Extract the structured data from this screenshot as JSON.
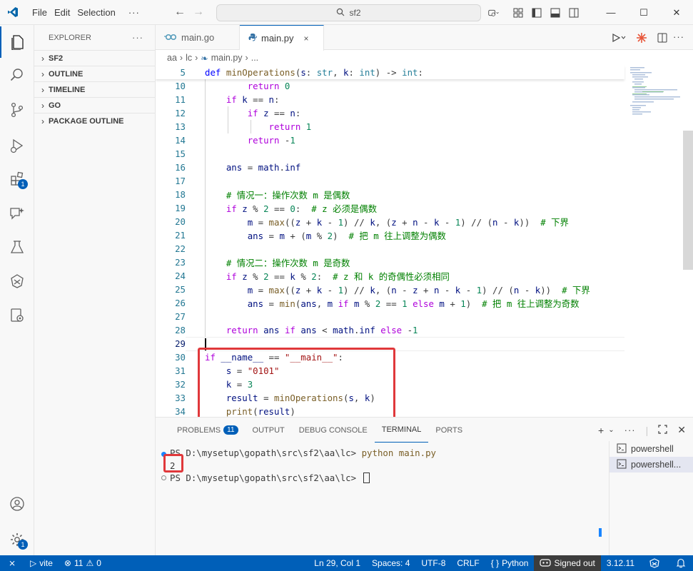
{
  "titlebar": {
    "menu": [
      "File",
      "Edit",
      "Selection"
    ],
    "more": "···",
    "search_text": "sf2"
  },
  "sidebar": {
    "title": "EXPLORER",
    "more": "···",
    "sections": [
      "SF2",
      "OUTLINE",
      "TIMELINE",
      "GO",
      "PACKAGE OUTLINE"
    ]
  },
  "activity": {
    "extensions_badge": "1",
    "accounts_badge": "1"
  },
  "tabs": [
    {
      "label": "main.go",
      "active": false
    },
    {
      "label": "main.py",
      "active": true,
      "close": "×"
    }
  ],
  "breadcrumb": [
    "aa",
    "lc",
    "main.py",
    "..."
  ],
  "editor": {
    "sticky": {
      "line": "5",
      "text": "def minOperations(s: str, k: int) -> int:"
    },
    "lines": [
      {
        "n": "10",
        "text": "        return 0"
      },
      {
        "n": "11",
        "text": "    if k == n:"
      },
      {
        "n": "12",
        "text": "        if z == n:"
      },
      {
        "n": "13",
        "text": "            return 1"
      },
      {
        "n": "14",
        "text": "        return -1"
      },
      {
        "n": "15",
        "text": ""
      },
      {
        "n": "16",
        "text": "    ans = math.inf"
      },
      {
        "n": "17",
        "text": ""
      },
      {
        "n": "18",
        "text": "    # 情况一：操作次数 m 是偶数"
      },
      {
        "n": "19",
        "text": "    if z % 2 == 0:  # z 必须是偶数"
      },
      {
        "n": "20",
        "text": "        m = max((z + k - 1) // k, (z + n - k - 1) // (n - k))  # 下界"
      },
      {
        "n": "21",
        "text": "        ans = m + (m % 2)  # 把 m 往上调整为偶数"
      },
      {
        "n": "22",
        "text": ""
      },
      {
        "n": "23",
        "text": "    # 情况二：操作次数 m 是奇数"
      },
      {
        "n": "24",
        "text": "    if z % 2 == k % 2:  # z 和 k 的奇偶性必须相同"
      },
      {
        "n": "25",
        "text": "        m = max((z + k - 1) // k, (n - z + n - k - 1) // (n - k))  # 下界"
      },
      {
        "n": "26",
        "text": "        ans = min(ans, m if m % 2 == 1 else m + 1)  # 把 m 往上调整为奇数"
      },
      {
        "n": "27",
        "text": ""
      },
      {
        "n": "28",
        "text": "    return ans if ans < math.inf else -1"
      },
      {
        "n": "29",
        "text": ""
      },
      {
        "n": "30",
        "text": "if __name__ == \"__main__\":"
      },
      {
        "n": "31",
        "text": "    s = \"0101\""
      },
      {
        "n": "32",
        "text": "    k = 3"
      },
      {
        "n": "33",
        "text": "    result = minOperations(s, k)"
      },
      {
        "n": "34",
        "text": "    print(result)"
      }
    ]
  },
  "panel": {
    "tabs": [
      "PROBLEMS",
      "OUTPUT",
      "DEBUG CONSOLE",
      "TERMINAL",
      "PORTS"
    ],
    "problems_count": "11",
    "active_tab": "TERMINAL",
    "terminal": {
      "line1_prompt": "PS D:\\mysetup\\gopath\\src\\sf2\\aa\\lc> ",
      "line1_cmd": "python main.py",
      "line2_output": "2",
      "line3_prompt": "PS D:\\mysetup\\gopath\\src\\sf2\\aa\\lc> "
    },
    "terminals": [
      "powershell",
      "powershell..."
    ]
  },
  "statusbar": {
    "remote": "⨯",
    "vite": "vite",
    "errors": "11",
    "warnings": "0",
    "position": "Ln 29, Col 1",
    "spaces": "Spaces: 4",
    "encoding": "UTF-8",
    "eol": "CRLF",
    "language_braces": "{ }",
    "language": "Python",
    "account": "Signed out",
    "python_version": "3.12.11"
  },
  "colors": {
    "accent": "#005fb8",
    "highlight": "#e0383b"
  }
}
